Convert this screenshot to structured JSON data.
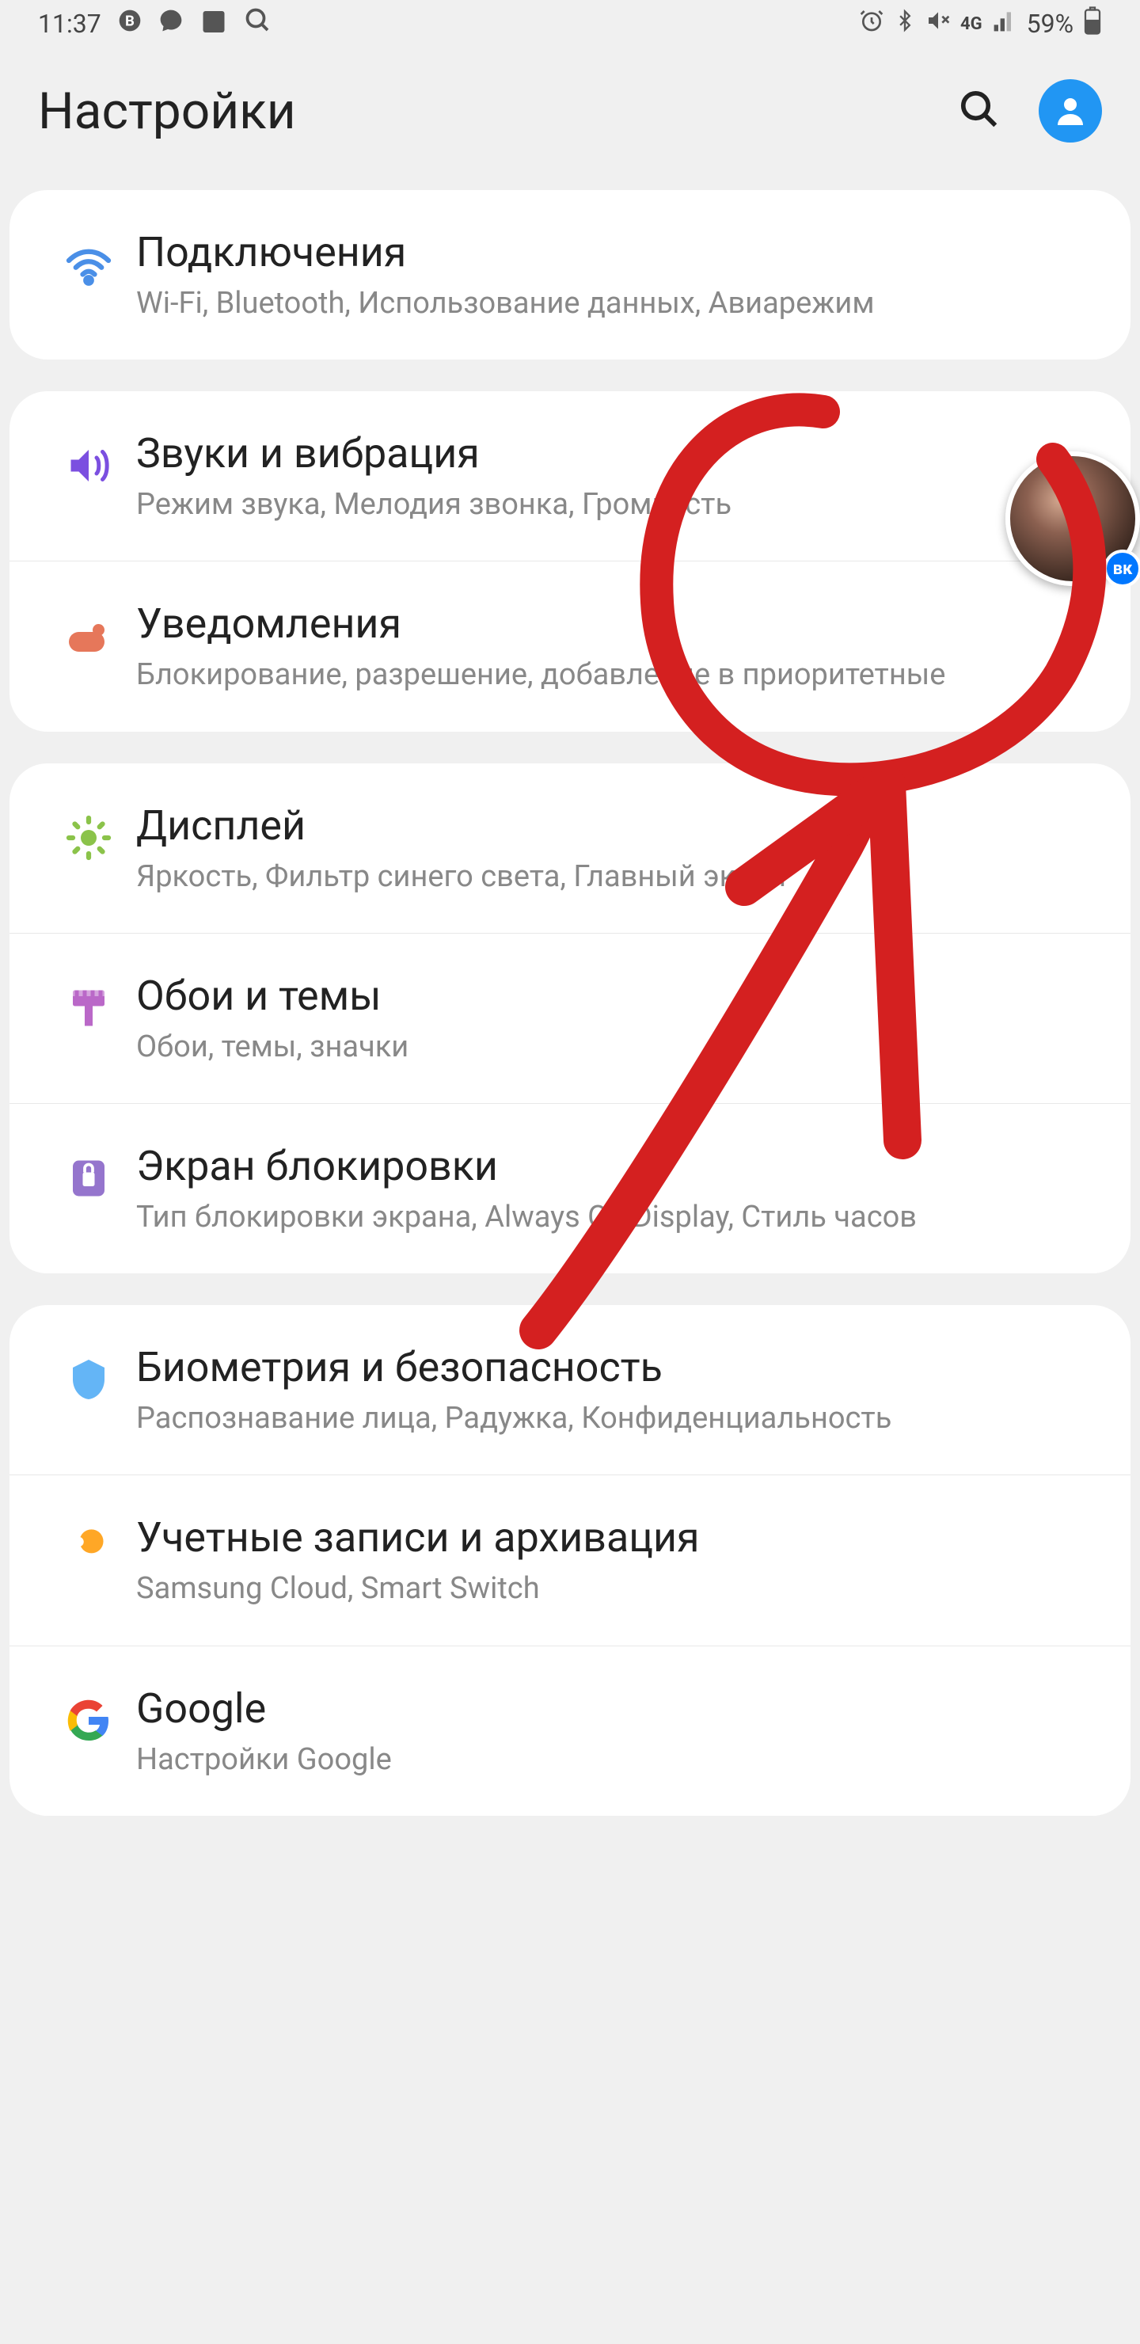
{
  "status_bar": {
    "time": "11:37",
    "battery": "59%",
    "network": "4G"
  },
  "header": {
    "title": "Настройки"
  },
  "groups": [
    {
      "items": [
        {
          "icon": "wifi",
          "color": "#4A8FE7",
          "title": "Подключения",
          "subtitle": "Wi-Fi, Bluetooth, Использование данных, Авиарежим"
        }
      ]
    },
    {
      "items": [
        {
          "icon": "sound",
          "color": "#7B4FE0",
          "title": "Звуки и вибрация",
          "subtitle": "Режим звука, Мелодия звонка, Громкость"
        },
        {
          "icon": "notifications",
          "color": "#E6775A",
          "title": "Уведомления",
          "subtitle": "Блокирование, разрешение, добавление в приоритетные"
        }
      ]
    },
    {
      "items": [
        {
          "icon": "display",
          "color": "#8BC34A",
          "title": "Дисплей",
          "subtitle": "Яркость, Фильтр синего света, Главный экран"
        },
        {
          "icon": "wallpaper",
          "color": "#BA68C8",
          "title": "Обои и темы",
          "subtitle": "Обои, темы, значки"
        },
        {
          "icon": "lock",
          "color": "#9575CD",
          "title": "Экран блокировки",
          "subtitle": "Тип блокировки экрана, Always On Display, Стиль часов"
        }
      ]
    },
    {
      "items": [
        {
          "icon": "security",
          "color": "#64B5F6",
          "title": "Биометрия и безопасность",
          "subtitle": "Распознавание лица, Радужка, Конфиденциальность"
        },
        {
          "icon": "accounts",
          "color": "#FFA726",
          "title": "Учетные записи и архивация",
          "subtitle": "Samsung Cloud, Smart Switch"
        },
        {
          "icon": "google",
          "color": "#4285F4",
          "title": "Google",
          "subtitle": "Настройки Google"
        }
      ]
    }
  ],
  "chat_badge": "вк"
}
